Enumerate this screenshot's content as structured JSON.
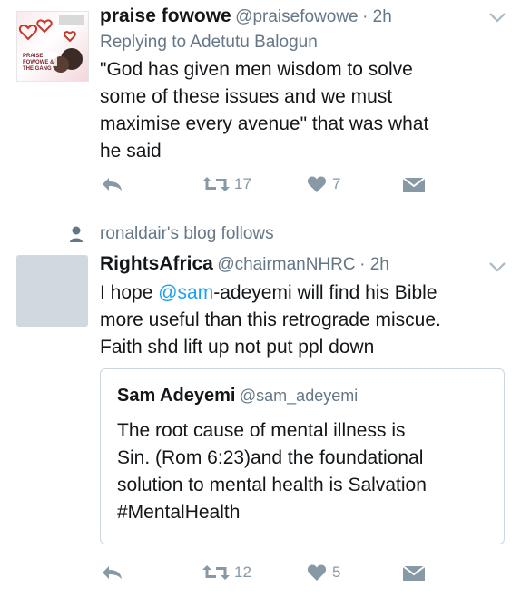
{
  "tweet1": {
    "author_name": "praise fowowe",
    "author_handle": "@praisefowowe",
    "time": "· 2h",
    "reply_to": "Replying to Adetutu Balogun",
    "text_lines": [
      "\"God has given men wisdom to solve",
      "some of these issues and we must",
      "maximise every avenue\" that was what",
      "he said"
    ],
    "retweets": "17",
    "likes": "7",
    "avatar_text": "PRAISE FOWOWE & THE GANG"
  },
  "social_context": "ronaldair's blog follows",
  "tweet2": {
    "author_name": "RightsAfrica",
    "author_handle": "@chairmanNHRC",
    "time": "· 2h",
    "line1_before": "I hope ",
    "line1_mention": "@sam",
    "line1_after": "-adeyemi will find his Bible",
    "line2": "more useful than this retrograde miscue.",
    "line3": "Faith shd lift up not put ppl down",
    "retweets": "12",
    "likes": "5",
    "quoted": {
      "author_name": "Sam Adeyemi",
      "author_handle": "@sam_adeyemi",
      "text_lines": [
        "The root cause of mental illness is",
        "Sin. (Rom 6:23)and the foundational",
        "solution to mental health is Salvation",
        "#MentalHealth"
      ]
    }
  },
  "colors": {
    "accent": "#1da1f2",
    "secondary_text": "#657786",
    "action_icons": "#8899a6",
    "divider": "#e1e8ed"
  }
}
